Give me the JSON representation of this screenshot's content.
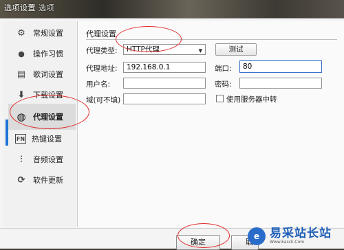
{
  "window": {
    "title": "选项设置",
    "subtitle": "选项"
  },
  "sidebar": {
    "items": [
      {
        "label": "常规设置",
        "icon": "gear-icon",
        "glyph": "⚙"
      },
      {
        "label": "操作习惯",
        "icon": "user-icon",
        "glyph": "👤"
      },
      {
        "label": "歌词设置",
        "icon": "lyrics-icon",
        "glyph": "▤"
      },
      {
        "label": "下载设置",
        "icon": "download-icon",
        "glyph": "⬇"
      },
      {
        "label": "代理设置",
        "icon": "globe-icon",
        "glyph": "◍"
      },
      {
        "label": "热键设置",
        "icon": "hotkey-icon",
        "glyph": "FN"
      },
      {
        "label": "音频设置",
        "icon": "equalizer-icon",
        "glyph": "⫶"
      },
      {
        "label": "软件更新",
        "icon": "update-icon",
        "glyph": "⟳"
      }
    ],
    "active_index": 4
  },
  "proxy": {
    "section_title": "代理设置",
    "type_label": "代理类型:",
    "type_value": "HTTP代理",
    "test_button": "测试",
    "address_label": "代理地址:",
    "address_value": "192.168.0.1",
    "port_label": "端口:",
    "port_value": "80",
    "username_label": "用户名:",
    "username_value": "",
    "password_label": "密码:",
    "password_value": "",
    "domain_label": "域(可不填)",
    "domain_value": "",
    "use_server_relay_label": "使用服务器中转",
    "use_server_relay_checked": false
  },
  "footer": {
    "ok_button": "确定",
    "cancel_button": "取"
  },
  "watermark": {
    "text": "易采站长站",
    "sub": "Www.Easck.Com"
  },
  "colors": {
    "annotation": "#e02a2a",
    "accent": "#1e74d6"
  }
}
